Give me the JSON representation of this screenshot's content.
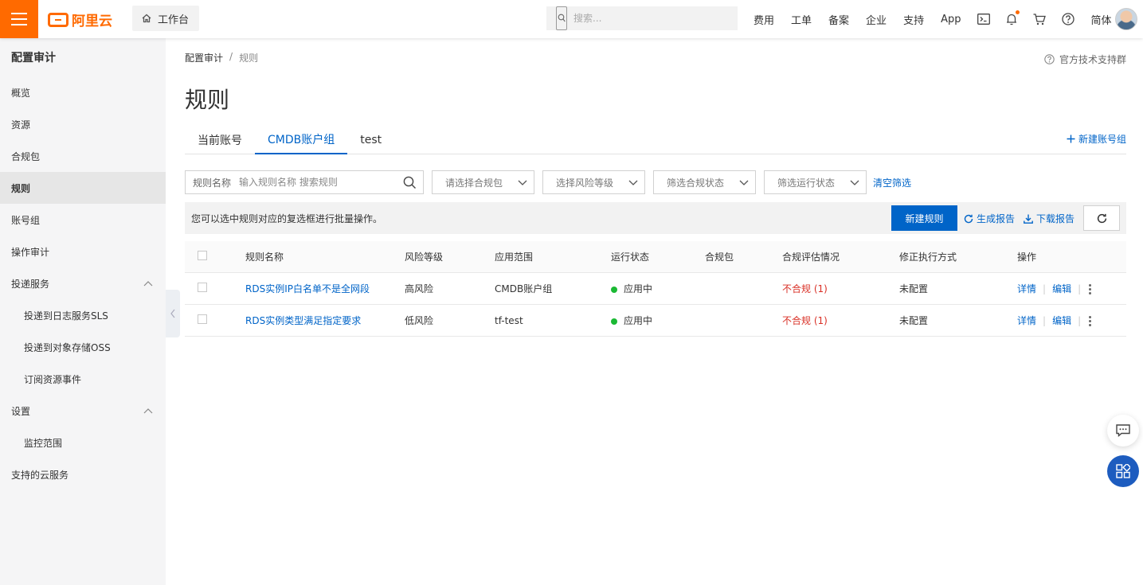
{
  "topbar": {
    "logo_text": "阿里云",
    "workbench": "工作台",
    "search_placeholder": "搜索...",
    "nav": [
      "费用",
      "工单",
      "备案",
      "企业",
      "支持",
      "App"
    ],
    "lang": "简体",
    "brand_color": "#ff6a00"
  },
  "sidebar": {
    "title": "配置审计",
    "items": [
      {
        "label": "概览"
      },
      {
        "label": "资源"
      },
      {
        "label": "合规包"
      },
      {
        "label": "规则"
      },
      {
        "label": "账号组"
      },
      {
        "label": "操作审计"
      },
      {
        "label": "投递服务"
      },
      {
        "label": "投递到日志服务SLS"
      },
      {
        "label": "投递到对象存储OSS"
      },
      {
        "label": "订阅资源事件"
      },
      {
        "label": "设置"
      },
      {
        "label": "监控范围"
      },
      {
        "label": "支持的云服务"
      }
    ]
  },
  "breadcrumb": {
    "parent": "配置审计",
    "sep": "/",
    "current": "规则"
  },
  "support_link": "官方技术支持群",
  "page_title": "规则",
  "tabs": [
    "当前账号",
    "CMDB账户组",
    "test"
  ],
  "new_group": "新建账号组",
  "filters": {
    "rule_name_label": "规则名称",
    "rule_name_placeholder": "输入规则名称 搜索规则",
    "pack": "请选择合规包",
    "risk": "选择风险等级",
    "compliance": "筛选合规状态",
    "run": "筛选运行状态",
    "clear": "清空筛选"
  },
  "toolbar": {
    "hint": "您可以选中规则对应的复选框进行批量操作。",
    "new_rule": "新建规则",
    "gen_report": "生成报告",
    "download_report": "下载报告"
  },
  "table": {
    "headers": [
      "规则名称",
      "风险等级",
      "应用范围",
      "运行状态",
      "合规包",
      "合规评估情况",
      "修正执行方式",
      "操作"
    ],
    "rows": [
      {
        "name": "RDS实例IP白名单不是全网段",
        "risk": "高风险",
        "scope": "CMDB账户组",
        "status": "应用中",
        "pack": "",
        "compliance": "不合规 (1)",
        "remediation": "未配置",
        "detail": "详情",
        "edit": "编辑"
      },
      {
        "name": "RDS实例类型满足指定要求",
        "risk": "低风险",
        "scope": "tf-test",
        "status": "应用中",
        "pack": "",
        "compliance": "不合规 (1)",
        "remediation": "未配置",
        "detail": "详情",
        "edit": "编辑"
      }
    ]
  },
  "colors": {
    "primary": "#0064c8",
    "danger": "#d93026",
    "success": "#1bb934"
  }
}
